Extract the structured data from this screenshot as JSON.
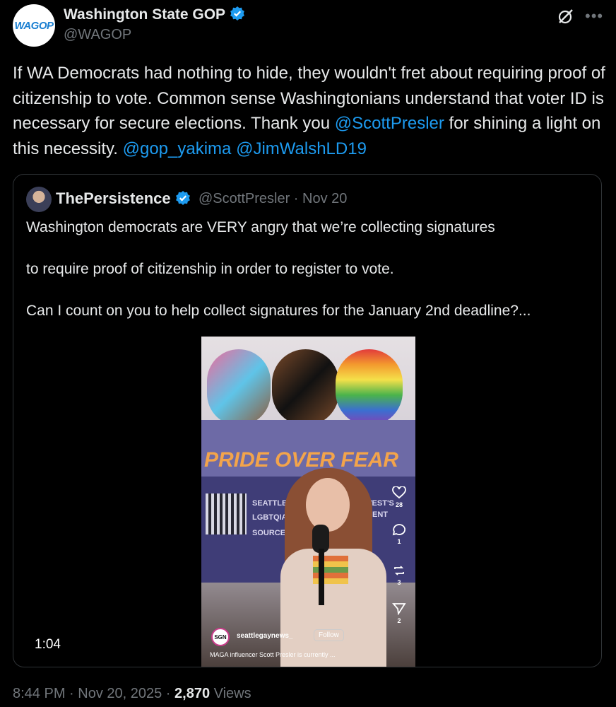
{
  "author": {
    "display_name": "Washington State GOP",
    "handle": "@WAGOP",
    "avatar_text": "WAGOP"
  },
  "tweet": {
    "text_parts": [
      "If WA Democrats had nothing to hide, they wouldn't fret about requiring proof of citizenship to vote. Common sense Washingtonians understand that voter ID is necessary for secure elections. Thank you ",
      "@ScottPresler",
      " for shining a light on this necessity. ",
      "@gop_yakima",
      " ",
      "@JimWalshLD19"
    ]
  },
  "quoted": {
    "display_name": "ThePersistence",
    "handle_time": "@ScottPresler · Nov 20",
    "paragraphs": [
      "Washington democrats are VERY angry that we’re collecting signatures",
      "to require proof of citizenship in order to register to vote.",
      "Can I count on you to help collect signatures for the January 2nd deadline?..."
    ],
    "video": {
      "duration": "1:04",
      "banner_word": "SGN",
      "banner_slogan": "PRIDE OVER FEAR",
      "sign_lines": [
        "SEATTLE & T",
        "LGBTQIA+",
        "SOURCE",
        "ORTHWEST'S",
        "TAINMENT"
      ],
      "likes": "28",
      "comments": "1",
      "reposts": "3",
      "shares": "2",
      "ig_logo_text": "SGN",
      "ig_username": "seattlegaynews_",
      "ig_follow": "Follow",
      "ig_caption": "MAGA influencer Scott Presler is currently ..."
    }
  },
  "footer": {
    "time_date": "8:44 PM · Nov 20, 2025 · ",
    "views_count": "2,870",
    "views_label": " Views"
  },
  "colors": {
    "accent": "#1d9bf0",
    "muted": "#71767b",
    "text": "#e7e9ea",
    "background": "#000000"
  }
}
